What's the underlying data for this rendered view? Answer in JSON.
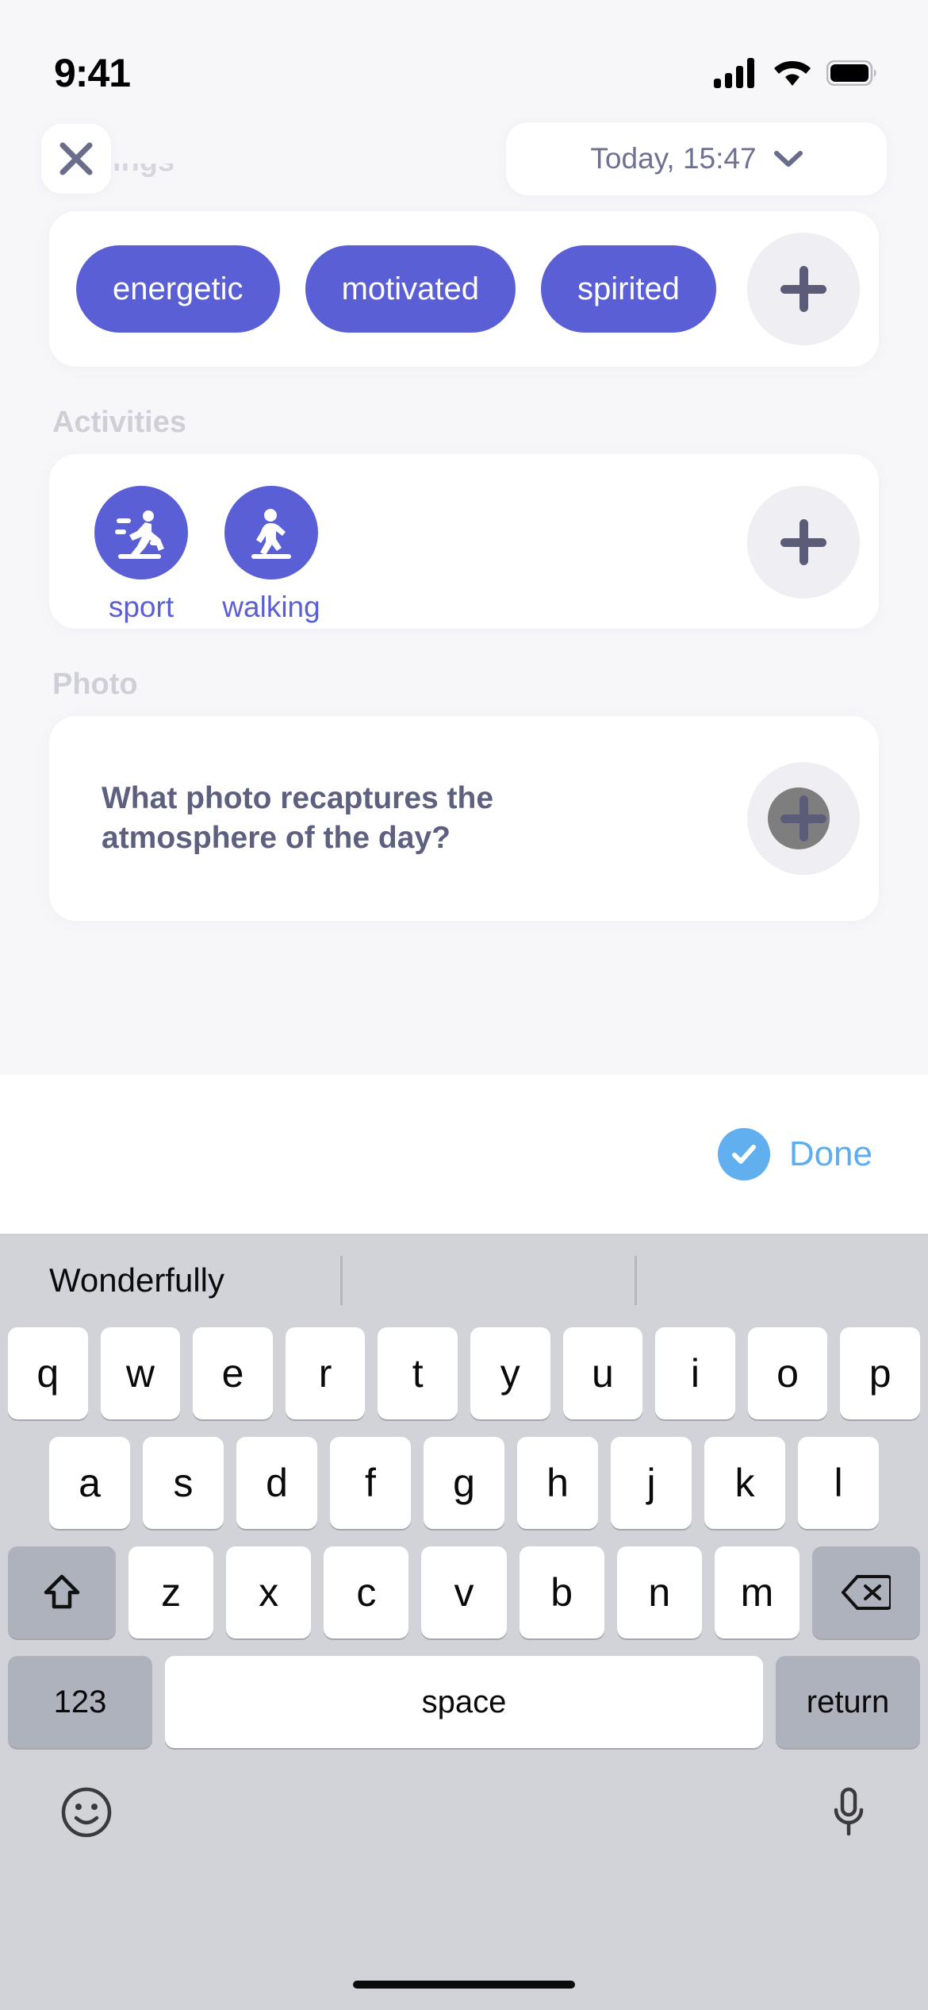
{
  "status_bar": {
    "time": "9:41",
    "cellular_icon": "cellular-bars-icon",
    "wifi_icon": "wifi-icon",
    "battery_icon": "battery-full-icon"
  },
  "header": {
    "close_icon": "close-x-icon",
    "date_label": "Today, 15:47",
    "chevron_icon": "chevron-down-icon"
  },
  "sections": {
    "feelings": {
      "title": "Feelings",
      "chips": [
        {
          "label": "energetic"
        },
        {
          "label": "motivated"
        },
        {
          "label": "spirited"
        }
      ],
      "add_icon": "plus-icon"
    },
    "activities": {
      "title": "Activities",
      "items": [
        {
          "label": "sport",
          "icon": "running-person-icon"
        },
        {
          "label": "walking",
          "icon": "walking-person-icon"
        }
      ],
      "add_icon": "plus-icon"
    },
    "photo": {
      "title": "Photo",
      "question": "What photo recaptures the atmosphere of the day?",
      "add_icon": "plus-icon"
    }
  },
  "done_bar": {
    "label": "Done",
    "check_icon": "check-circle-icon"
  },
  "keyboard": {
    "suggestions": [
      "Wonderfully",
      "",
      ""
    ],
    "row1": [
      "q",
      "w",
      "e",
      "r",
      "t",
      "y",
      "u",
      "i",
      "o",
      "p"
    ],
    "row2": [
      "a",
      "s",
      "d",
      "f",
      "g",
      "h",
      "j",
      "k",
      "l"
    ],
    "row3": [
      "z",
      "x",
      "c",
      "v",
      "b",
      "n",
      "m"
    ],
    "shift_icon": "shift-up-arrow-icon",
    "delete_icon": "backspace-delete-icon",
    "numbers_label": "123",
    "space_label": "space",
    "return_label": "return",
    "emoji_icon": "emoji-smiley-icon",
    "mic_icon": "microphone-icon"
  },
  "colors": {
    "accent_purple": "#5A5FD6",
    "done_blue": "#5DADF0",
    "background": "#F7F7FA",
    "card": "#FFFFFF",
    "section_label": "#CFCFD8"
  }
}
